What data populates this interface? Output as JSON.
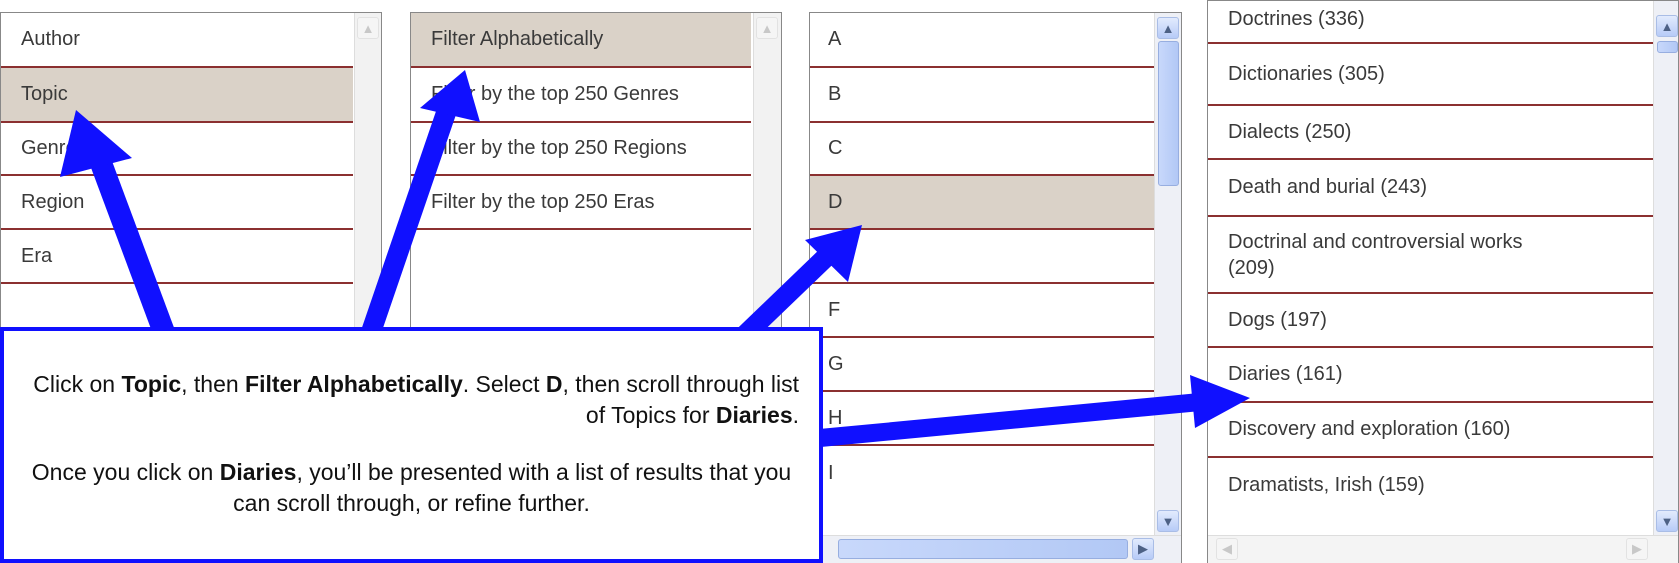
{
  "panel1": {
    "items": [
      "Author",
      "Topic",
      "Genre",
      "Region",
      "Era"
    ],
    "selected": "Topic"
  },
  "panel2": {
    "items": [
      "Filter Alphabetically",
      "Filter by the top 250 Genres",
      "Filter by the top 250 Regions",
      "Filter by the top 250 Eras"
    ],
    "selected": "Filter Alphabetically"
  },
  "panel3": {
    "items": [
      "A",
      "B",
      "C",
      "D",
      "E",
      "F",
      "G",
      "H",
      "I"
    ],
    "selected": "D"
  },
  "panel4": {
    "items": [
      "Doctrines (336)",
      "Dictionaries (305)",
      "Dialects (250)",
      "Death and burial (243)",
      "Doctrinal and controversial works (209)",
      "Dogs (197)",
      "Diaries (161)",
      "Discovery and exploration (160)",
      "Dramatists, Irish (159)"
    ]
  },
  "callout": {
    "p1_a": "Click on ",
    "p1_topic": "Topic",
    "p1_b": ", then ",
    "p1_filter": "Filter Alphabetically",
    "p1_c": ". Select ",
    "p1_d": "D",
    "p1_e": ", then scroll through list of Topics for ",
    "p1_diaries": "Diaries",
    "p1_f": ".",
    "p2_a": "Once you click on ",
    "p2_diaries": "Diaries",
    "p2_b": ", you’ll be presented with a list of results that you can scroll through, or refine further."
  },
  "colors": {
    "arrow": "#1010ff",
    "row_divider": "#8b3030",
    "selected_row": "#dad2c8"
  }
}
